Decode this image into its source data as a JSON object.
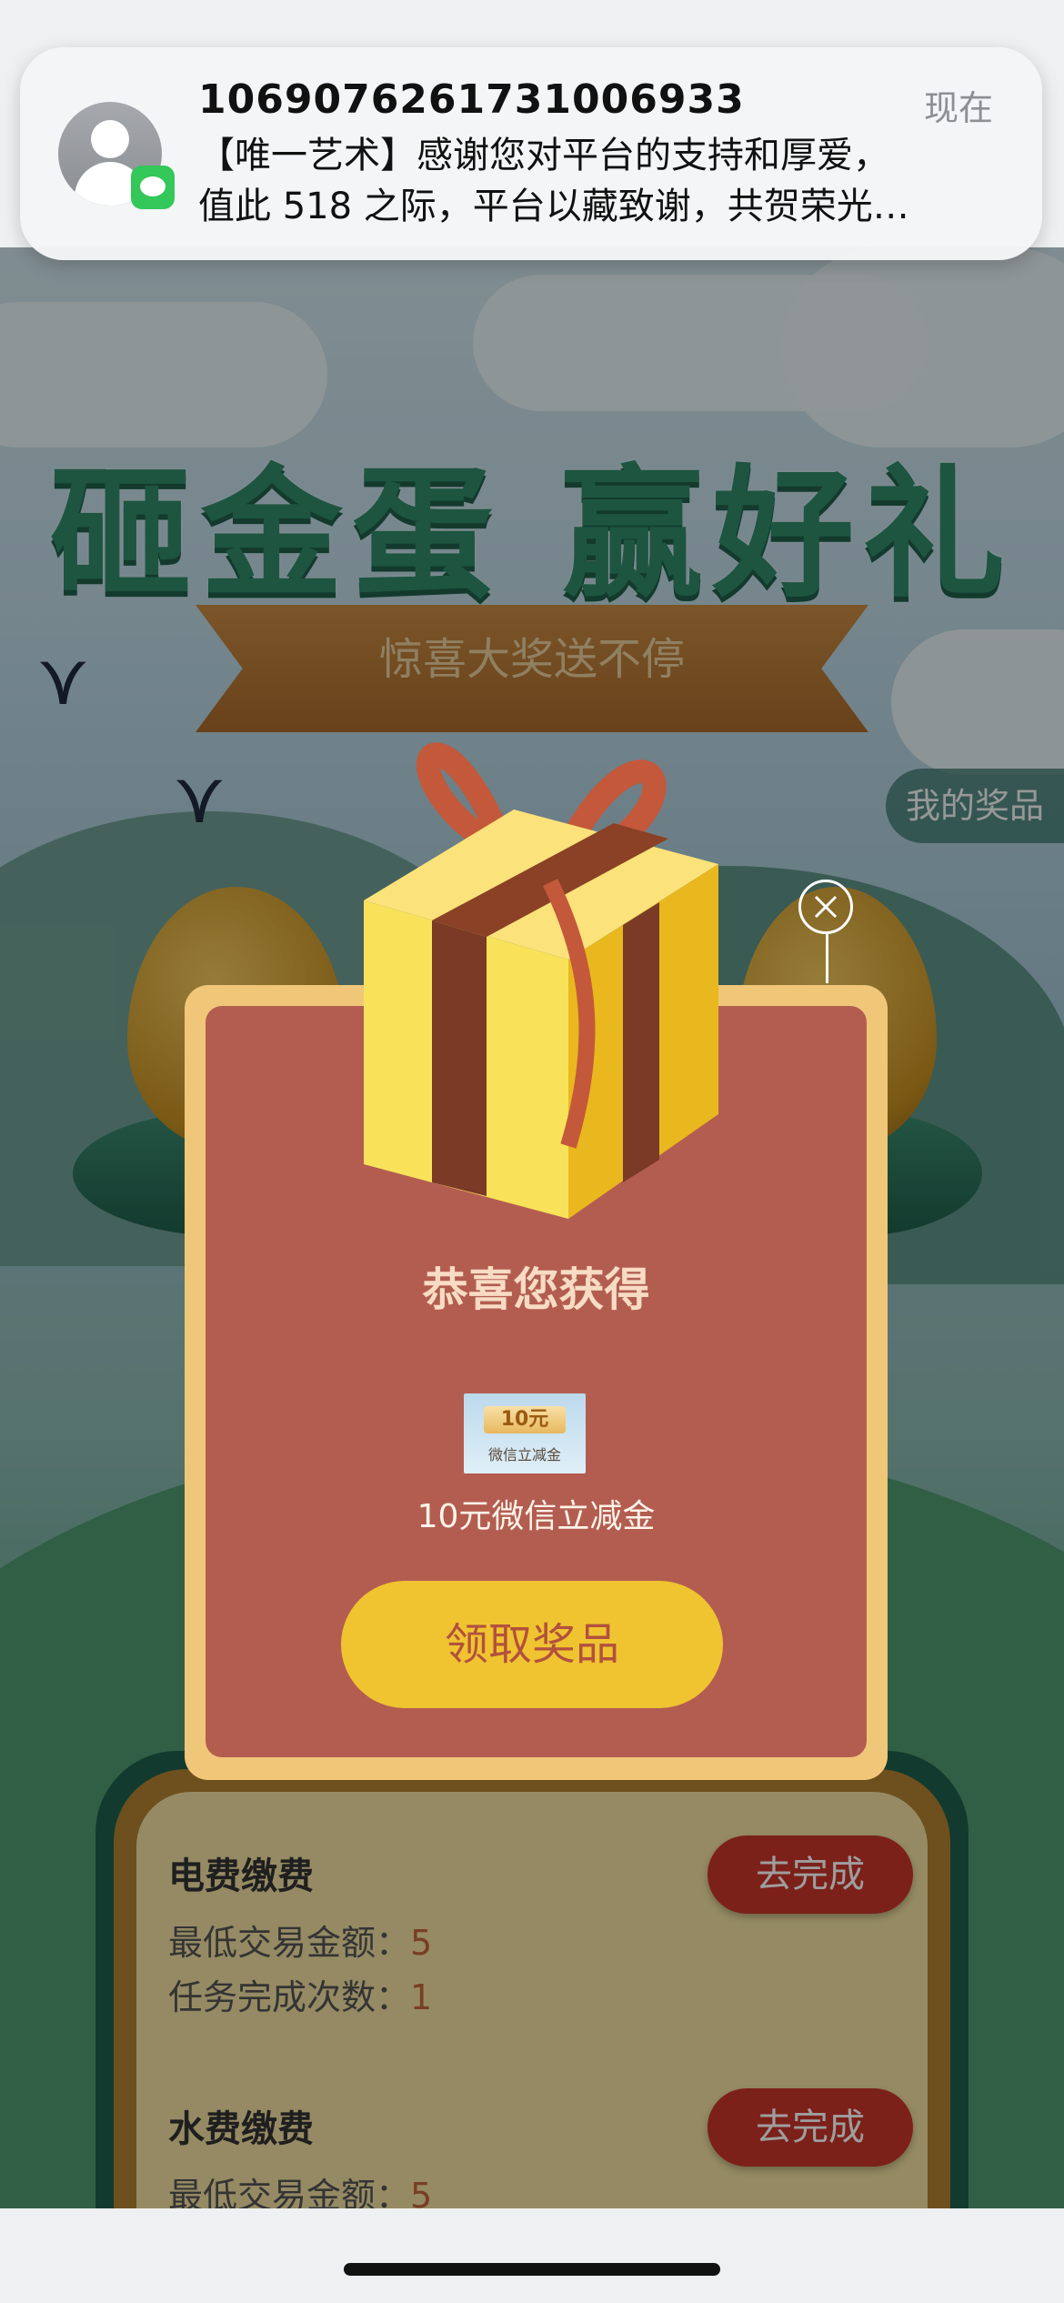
{
  "notification": {
    "sender": "1069076261731006933",
    "time": "现在",
    "line1": "【唯一艺术】感谢您对平台的支持和厚爱，",
    "line2": "值此 518 之际，平台以藏致谢，共贺荣光…"
  },
  "banner": {
    "title": "砸金蛋 赢好礼",
    "subtitle": "惊喜大奖送不停"
  },
  "my_prizes_label": "我的奖品",
  "modal": {
    "title": "恭喜您获得",
    "prize_image_amount": "10元",
    "prize_image_caption": "微信立减金",
    "prize_name": "10元微信立减金",
    "claim_label": "领取奖品"
  },
  "tasks": [
    {
      "name": "电费缴费",
      "min_amount_label": "最低交易金额：",
      "min_amount_value": "5",
      "count_label": "任务完成次数：",
      "count_value": "1",
      "action": "去完成"
    },
    {
      "name": "水费缴费",
      "min_amount_label": "最低交易金额：",
      "min_amount_value": "5",
      "action": "去完成"
    }
  ]
}
